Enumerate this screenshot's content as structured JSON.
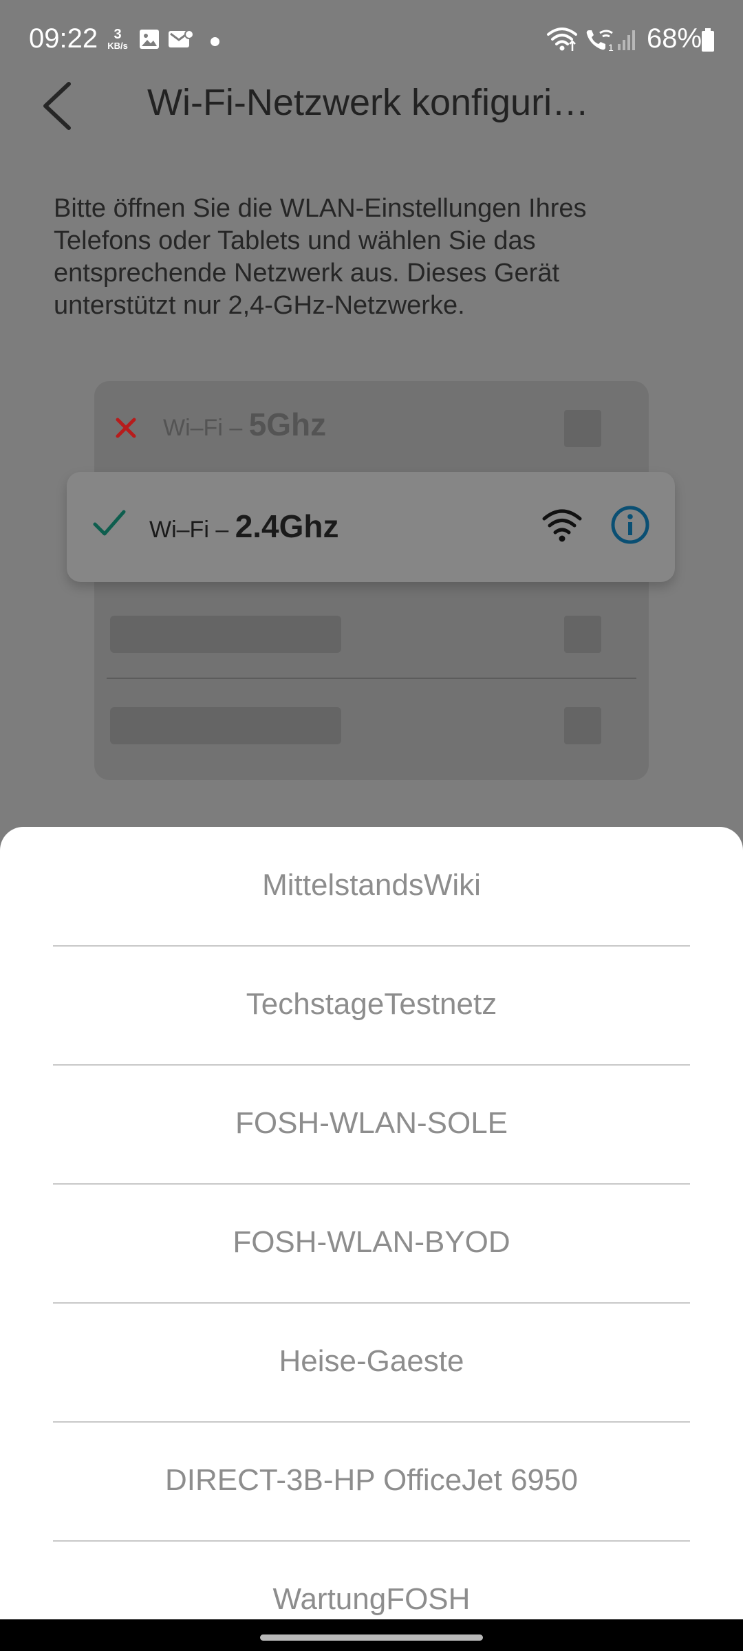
{
  "status_bar": {
    "time": "09:22",
    "speed_value": "3",
    "speed_unit": "KB/s",
    "battery": "68%",
    "icons": [
      "image-icon",
      "mail-icon",
      "dot-icon",
      "wifi-status-icon",
      "wifi-call-icon",
      "signal-icon",
      "battery-icon"
    ]
  },
  "header": {
    "title": "Wi-Fi-Netzwerk konfiguri…",
    "back_icon": "chevron-left-icon"
  },
  "instruction": "Bitte öffnen Sie die WLAN-Einstellungen Ihres Telefons oder Tablets und wählen Sie das entsprechende Netzwerk aus. Dieses Gerät unterstützt nur 2,4-GHz-Netzwerke.",
  "illustration": {
    "wrong": {
      "prefix": "Wi–Fi – ",
      "band": "5Ghz",
      "icon": "x-icon"
    },
    "correct": {
      "prefix": "Wi–Fi – ",
      "band": "2.4Ghz",
      "icon": "check-icon"
    },
    "colors": {
      "wrong": "#b71c1c",
      "correct": "#0e5e4e",
      "info": "#0a4f73"
    }
  },
  "networks": [
    "MittelstandsWiki",
    "TechstageTestnetz",
    "FOSH-WLAN-SOLE",
    "FOSH-WLAN-BYOD",
    "Heise-Gaeste",
    "DIRECT-3B-HP OfficeJet 6950",
    "WartungFOSH"
  ]
}
